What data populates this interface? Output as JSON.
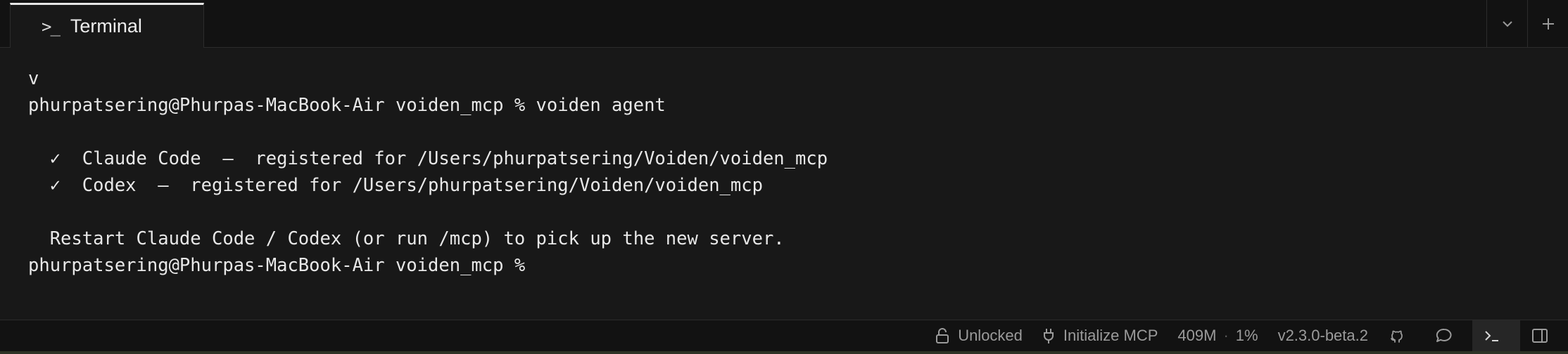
{
  "tabs": [
    {
      "label": "Terminal",
      "icon": "terminal-prompt-icon"
    }
  ],
  "tab_actions": {
    "dropdown_icon": "chevron-down-icon",
    "add_icon": "plus-icon"
  },
  "terminal": {
    "lines": [
      "v",
      "phurpatsering@Phurpas-MacBook-Air voiden_mcp % voiden agent",
      "",
      "  ✓  Claude Code  —  registered for /Users/phurpatsering/Voiden/voiden_mcp",
      "  ✓  Codex  —  registered for /Users/phurpatsering/Voiden/voiden_mcp",
      "",
      "  Restart Claude Code / Codex (or run /mcp) to pick up the new server.",
      "phurpatsering@Phurpas-MacBook-Air voiden_mcp % "
    ]
  },
  "statusbar": {
    "lock_label": "Unlocked",
    "mcp_label": "Initialize MCP",
    "memory": "409M",
    "separator": "·",
    "cpu": "1%",
    "version": "v2.3.0-beta.2"
  },
  "colors": {
    "background": "#181818",
    "chrome": "#121212",
    "text": "#e8e8e8",
    "muted": "#9b9b9b",
    "border": "#2c2c2c"
  }
}
